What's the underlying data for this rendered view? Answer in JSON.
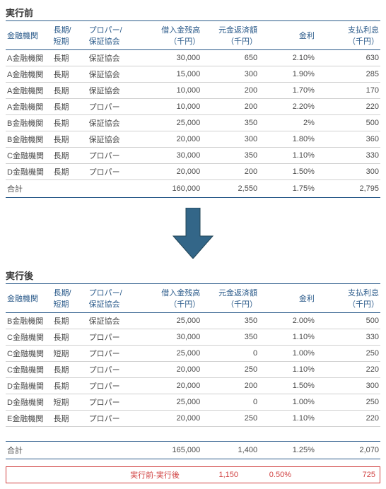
{
  "before": {
    "title": "実行前",
    "headers": [
      "金融機関",
      "長期/\n短期",
      "プロパー/\n保証協会",
      "借入金残高\n（千円）",
      "元金返済額\n（千円）",
      "金利",
      "支払利息\n（千円）"
    ],
    "rows": [
      {
        "c0": "A金融機関",
        "c1": "長期",
        "c2": "保証協会",
        "c3": "30,000",
        "c4": "650",
        "c5": "2.10%",
        "c6": "630"
      },
      {
        "c0": "A金融機関",
        "c1": "長期",
        "c2": "保証協会",
        "c3": "15,000",
        "c4": "300",
        "c5": "1.90%",
        "c6": "285"
      },
      {
        "c0": "A金融機関",
        "c1": "長期",
        "c2": "保証協会",
        "c3": "10,000",
        "c4": "200",
        "c5": "1.70%",
        "c6": "170"
      },
      {
        "c0": "A金融機関",
        "c1": "長期",
        "c2": "プロパー",
        "c3": "10,000",
        "c4": "200",
        "c5": "2.20%",
        "c6": "220"
      },
      {
        "c0": "B金融機関",
        "c1": "長期",
        "c2": "保証協会",
        "c3": "25,000",
        "c4": "350",
        "c5": "2%",
        "c6": "500"
      },
      {
        "c0": "B金融機関",
        "c1": "長期",
        "c2": "保証協会",
        "c3": "20,000",
        "c4": "300",
        "c5": "1.80%",
        "c6": "360"
      },
      {
        "c0": "C金融機関",
        "c1": "長期",
        "c2": "プロパー",
        "c3": "30,000",
        "c4": "350",
        "c5": "1.10%",
        "c6": "330"
      },
      {
        "c0": "D金融機関",
        "c1": "長期",
        "c2": "プロパー",
        "c3": "20,000",
        "c4": "200",
        "c5": "1.50%",
        "c6": "300"
      }
    ],
    "total": {
      "label": "合計",
      "c3": "160,000",
      "c4": "2,550",
      "c5": "1.75%",
      "c6": "2,795"
    }
  },
  "after": {
    "title": "実行後",
    "headers": [
      "金融機関",
      "長期/\n短期",
      "プロパー/\n保証協会",
      "借入金残高\n（千円）",
      "元金返済額\n（千円）",
      "金利",
      "支払利息\n（千円）"
    ],
    "rows": [
      {
        "c0": "B金融機関",
        "c1": "長期",
        "c2": "保証協会",
        "c3": "25,000",
        "c4": "350",
        "c5": "2.00%",
        "c6": "500"
      },
      {
        "c0": "C金融機関",
        "c1": "長期",
        "c2": "プロパー",
        "c3": "30,000",
        "c4": "350",
        "c5": "1.10%",
        "c6": "330"
      },
      {
        "c0": "C金融機関",
        "c1": "短期",
        "c2": "プロパー",
        "c3": "25,000",
        "c4": "0",
        "c5": "1.00%",
        "c6": "250"
      },
      {
        "c0": "C金融機関",
        "c1": "長期",
        "c2": "プロパー",
        "c3": "20,000",
        "c4": "250",
        "c5": "1.10%",
        "c6": "220"
      },
      {
        "c0": "D金融機関",
        "c1": "長期",
        "c2": "プロパー",
        "c3": "20,000",
        "c4": "200",
        "c5": "1.50%",
        "c6": "300"
      },
      {
        "c0": "D金融機関",
        "c1": "短期",
        "c2": "プロパー",
        "c3": "25,000",
        "c4": "0",
        "c5": "1.00%",
        "c6": "250"
      },
      {
        "c0": "E金融機関",
        "c1": "長期",
        "c2": "プロパー",
        "c3": "20,000",
        "c4": "250",
        "c5": "1.10%",
        "c6": "220"
      }
    ],
    "total": {
      "label": "合計",
      "c3": "165,000",
      "c4": "1,400",
      "c5": "1.25%",
      "c6": "2,070"
    }
  },
  "diff": {
    "label": "実行前-実行後",
    "c4": "1,150",
    "c5": "0.50%",
    "c6": "725"
  }
}
